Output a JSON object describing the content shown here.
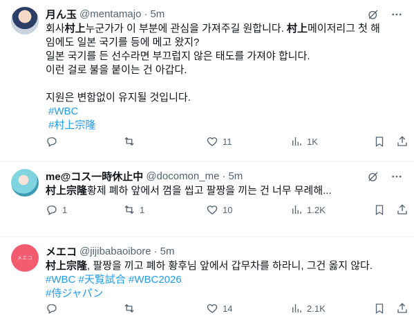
{
  "tweets": [
    {
      "name": "月ん玉",
      "handle": "@mentamajo",
      "dot": "·",
      "time": "5m",
      "lines": [
        [
          {
            "t": "회사"
          },
          {
            "t": "村上",
            "b": true
          },
          {
            "t": "누군가가 이 부분에 관심을 가져주길 원합니다. "
          },
          {
            "t": "村上",
            "b": true
          },
          {
            "t": "메이저리그 첫 해"
          }
        ],
        [
          {
            "t": "임에도 일본 국기를 등에 메고 왔지?"
          }
        ],
        [
          {
            "t": "일본 국기를 든 선수라면 부끄럽지 않은 태도를 가져야 합니다."
          }
        ],
        [
          {
            "t": "이런 걸로 불을 붙이는 건 아갑다."
          }
        ],
        [
          {
            "t": ""
          }
        ],
        [
          {
            "t": "지원은 변함없이 유지될 것입니다."
          }
        ]
      ],
      "tags": [
        "#WBC",
        "#村上宗隆"
      ],
      "stats": {
        "reply": "",
        "retweet": "",
        "like": "11",
        "views": "1K"
      }
    },
    {
      "name": "me@コス一時休止中",
      "handle": "@docomon_me",
      "dot": "·",
      "time": "5m",
      "lines": [
        [
          {
            "t": "村上宗隆",
            "b": true
          },
          {
            "t": "황제 폐하 앞에서 껌을 씹고 팔짱을 끼는 건 너무 무례해..."
          }
        ]
      ],
      "tags": [],
      "stats": {
        "reply": "1",
        "retweet": "1",
        "like": "10",
        "views": "1.2K"
      }
    },
    {
      "name": "メエコ",
      "handle": "@jijibabaoibore",
      "dot": "·",
      "time": "5m",
      "avatar_text": "メエコ",
      "lines": [
        [
          {
            "t": "村上宗隆",
            "b": true
          },
          {
            "t": ", 팔짱을 끼고 폐하 황후님 앞에서 갑무차를 하라니, 그건 옳지 않다."
          }
        ]
      ],
      "tags_line1": [
        "#WBC",
        "#天覧試合",
        "#WBC2026"
      ],
      "tags_line2": [
        "#侍ジャパン"
      ],
      "stats": {
        "reply": "",
        "retweet": "",
        "like": "14",
        "views": "2.1K"
      }
    }
  ],
  "colors": {
    "link": "#1d9bf0",
    "muted": "#536471",
    "text": "#0f1419"
  }
}
